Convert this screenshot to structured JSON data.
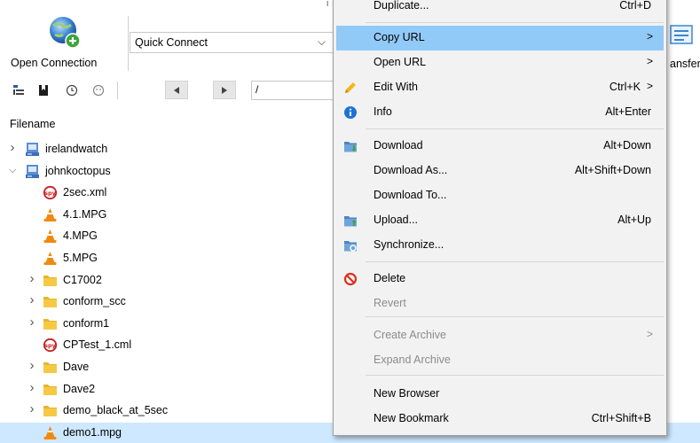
{
  "toolbar": {
    "open_connection_label": "Open Connection",
    "quick_connect": {
      "value": "Quick Connect"
    },
    "transfers_label": "ansfer",
    "top_fragment": "I"
  },
  "navbar": {
    "path": "/"
  },
  "file_list": {
    "column_header": "Filename",
    "rows": [
      {
        "name": "irelandwatch",
        "type": "drive",
        "expander": ">"
      },
      {
        "name": "johnkoctopus",
        "type": "drive",
        "expander": "v"
      },
      {
        "name": "2sec.xml",
        "type": "spy"
      },
      {
        "name": "4.1.MPG",
        "type": "vlc"
      },
      {
        "name": "4.MPG",
        "type": "vlc"
      },
      {
        "name": "5.MPG",
        "type": "vlc"
      },
      {
        "name": "C17002",
        "type": "folder",
        "expander": ">"
      },
      {
        "name": "conform_scc",
        "type": "folder",
        "expander": ">"
      },
      {
        "name": "conform1",
        "type": "folder",
        "expander": ">"
      },
      {
        "name": "CPTest_1.cml",
        "type": "spy"
      },
      {
        "name": "Dave",
        "type": "folder",
        "expander": ">"
      },
      {
        "name": "Dave2",
        "type": "folder",
        "expander": ">"
      },
      {
        "name": "demo_black_at_5sec",
        "type": "folder",
        "expander": ">"
      },
      {
        "name": "demo1.mpg",
        "type": "vlc",
        "selected": true
      }
    ]
  },
  "context_menu": {
    "items": [
      {
        "label": "Duplicate...",
        "shortcut": "Ctrl+D"
      },
      {
        "label": "Copy URL",
        "submenu": ">",
        "highlighted": true
      },
      {
        "label": "Open URL",
        "submenu": ">"
      },
      {
        "label": "Edit With",
        "shortcut": "Ctrl+K",
        "submenu": ">",
        "icon": "pencil-icon"
      },
      {
        "label": "Info",
        "shortcut": "Alt+Enter",
        "icon": "info-icon"
      },
      {
        "label": "Download",
        "shortcut": "Alt+Down",
        "icon": "download-folder-icon"
      },
      {
        "label": "Download As...",
        "shortcut": "Alt+Shift+Down"
      },
      {
        "label": "Download To..."
      },
      {
        "label": "Upload...",
        "shortcut": "Alt+Up",
        "icon": "upload-folder-icon"
      },
      {
        "label": "Synchronize...",
        "icon": "sync-folder-icon"
      },
      {
        "label": "Delete",
        "icon": "delete-icon"
      },
      {
        "label": "Revert",
        "disabled": true
      },
      {
        "label": "Create Archive",
        "submenu": ">",
        "disabled": true
      },
      {
        "label": "Expand Archive",
        "disabled": true
      },
      {
        "label": "New Browser"
      },
      {
        "label": "New Bookmark",
        "shortcut": "Ctrl+Shift+B"
      }
    ]
  },
  "colors": {
    "menu_highlight": "#91c9f7",
    "row_selected": "#cde8ff",
    "menu_background": "#f2f2f2",
    "folder": "#f6c945",
    "vlc_cone": "#f08a0f",
    "delete_red": "#d9321f",
    "info_blue": "#1e73d1"
  }
}
